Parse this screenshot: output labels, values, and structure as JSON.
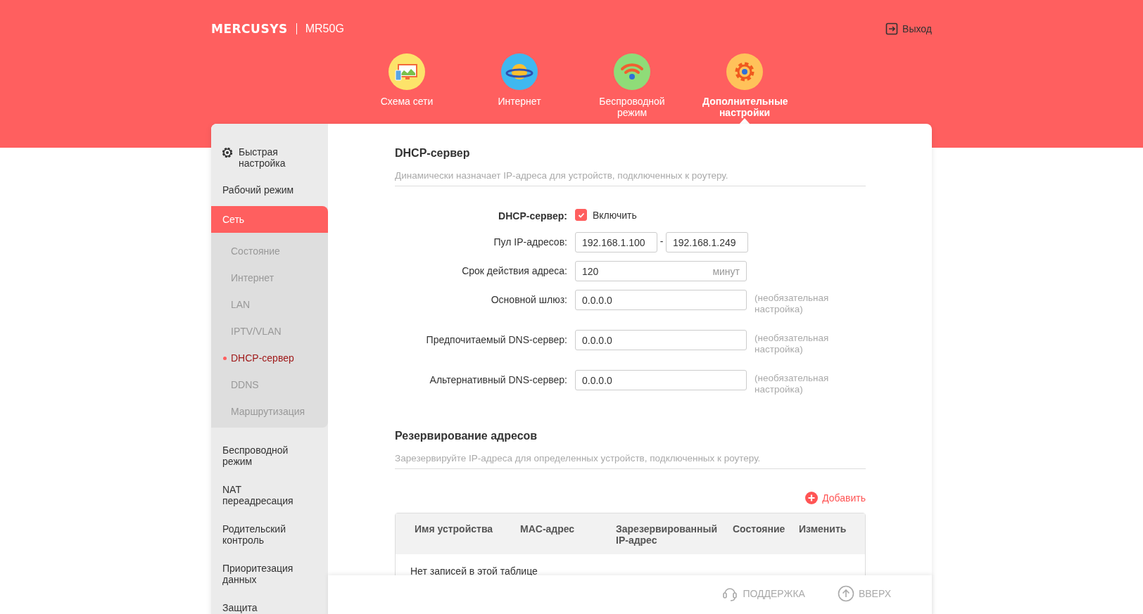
{
  "header": {
    "brand": "MERCUSYS",
    "model": "MR50G",
    "logout": "Выход"
  },
  "nav": [
    {
      "kind": "network-map",
      "label": "Схема сети",
      "selected": false
    },
    {
      "kind": "internet",
      "label": "Интернет",
      "selected": false
    },
    {
      "kind": "wireless",
      "label": "Беспроводной режим",
      "selected": false
    },
    {
      "kind": "advanced",
      "label": "Дополнительные настройки",
      "selected": true
    }
  ],
  "sidebar": {
    "items": [
      {
        "kind": "quick",
        "label": "Быстрая настройка",
        "selected": false
      },
      {
        "kind": "menu",
        "label": "Рабочий режим",
        "selected": false
      },
      {
        "kind": "menu",
        "label": "Сеть",
        "selected": true,
        "expanded": true,
        "children": [
          {
            "label": "Состояние",
            "selected": false
          },
          {
            "label": "Интернет",
            "selected": false
          },
          {
            "label": "LAN",
            "selected": false
          },
          {
            "label": "IPTV/VLAN",
            "selected": false
          },
          {
            "label": "DHCP-сервер",
            "selected": true
          },
          {
            "label": "DDNS",
            "selected": false
          },
          {
            "label": "Маршрутизация",
            "selected": false
          }
        ]
      },
      {
        "kind": "menu",
        "label": "Беспроводной режим",
        "selected": false
      },
      {
        "kind": "menu",
        "label": "NAT переадресация",
        "selected": false
      },
      {
        "kind": "menu",
        "label": "Родительский контроль",
        "selected": false
      },
      {
        "kind": "menu",
        "label": "Приоритезация данных",
        "selected": false
      },
      {
        "kind": "menu",
        "label": "Защита",
        "selected": false
      }
    ]
  },
  "dhcp": {
    "title": "DHCP-сервер",
    "description": "Динамически назначает IP-адреса для устройств, подключенных к роутеру.",
    "fields": [
      {
        "kind": "checkbox",
        "label": "DHCP-сервер:",
        "checked": true,
        "option": "Включить"
      },
      {
        "kind": "range",
        "label": "Пул IP-адресов:",
        "from": "192.168.1.100",
        "separator": "-",
        "to": "192.168.1.249"
      },
      {
        "kind": "unit",
        "label": "Срок действия адреса:",
        "value": "120",
        "unit": "минут"
      },
      {
        "kind": "text",
        "label": "Основной шлюз:",
        "value": "0.0.0.0",
        "hint": "(необязательная настройка)"
      },
      {
        "kind": "text",
        "label": "Предпочитаемый DNS-сервер:",
        "value": "0.0.0.0",
        "hint": "(необязательная настройка)"
      },
      {
        "kind": "text",
        "label": "Альтернативный DNS-сервер:",
        "value": "0.0.0.0",
        "hint": "(необязательная настройка)"
      }
    ]
  },
  "reservation": {
    "title": "Резервирование адресов",
    "description": "Зарезервируйте IP-адреса для определенных устройств, подключенных к роутеру.",
    "add": "Добавить",
    "table": {
      "columns": [
        "Имя устройства",
        "MAC-адрес",
        "Зарезервированный IP-адрес",
        "Состояние",
        "Изменить"
      ],
      "empty_message": "Нет записей в этой таблице"
    }
  },
  "footer": {
    "support": "ПОДДЕРЖКА",
    "top": "ВВЕРХ"
  }
}
